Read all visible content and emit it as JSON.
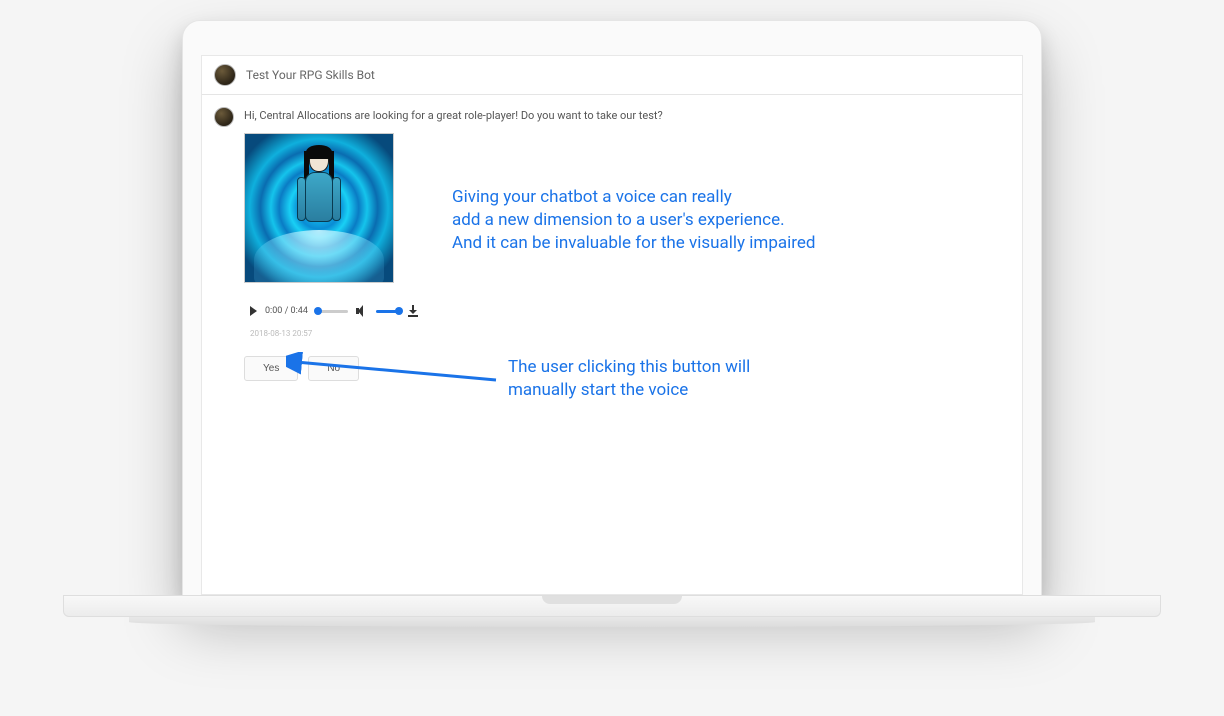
{
  "header": {
    "title": "Test Your RPG Skills Bot"
  },
  "chat": {
    "message": "Hi, Central Allocations are looking for a great role-player! Do you want to take our test?",
    "audio": {
      "current_time": "0:00",
      "duration": "0:44"
    },
    "timestamp": "2018-08-13 20:57",
    "buttons": {
      "yes": "Yes",
      "no": "No"
    }
  },
  "annotations": {
    "top": "Giving your chatbot a voice can really\nadd a new dimension to a user's experience.\nAnd it can be invaluable for the visually impaired",
    "bottom": "The user clicking this button will\nmanually start the voice"
  },
  "colors": {
    "accent": "#1a73e8"
  }
}
